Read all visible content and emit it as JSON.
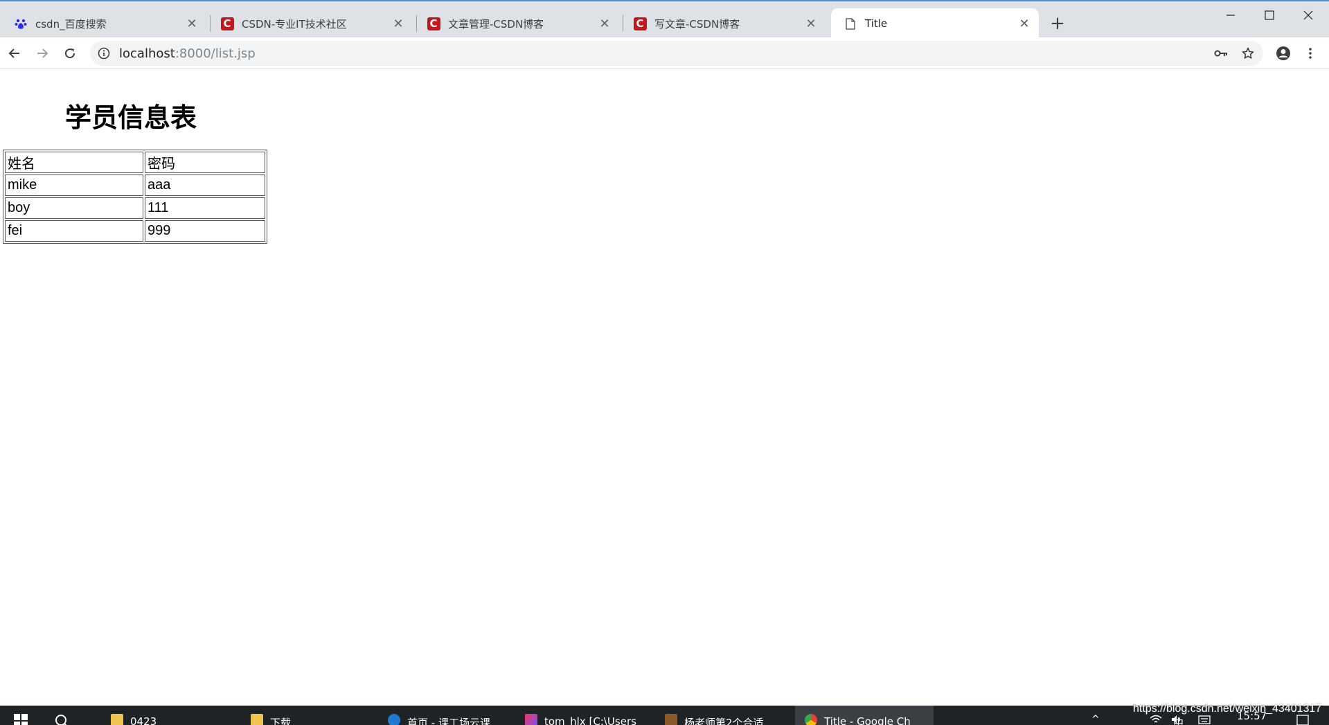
{
  "tabs": [
    {
      "title": "csdn_百度搜索",
      "icon": "baidu-paw-icon"
    },
    {
      "title": "CSDN-专业IT技术社区",
      "icon": "csdn-logo-icon"
    },
    {
      "title": "文章管理-CSDN博客",
      "icon": "csdn-logo-icon"
    },
    {
      "title": "写文章-CSDN博客",
      "icon": "csdn-logo-icon"
    },
    {
      "title": "Title",
      "icon": "document-icon",
      "active": true
    }
  ],
  "address_bar": {
    "host": "localhost",
    "path": ":8000/list.jsp"
  },
  "page": {
    "heading": "学员信息表",
    "table": {
      "headers": [
        "姓名",
        "密码"
      ],
      "rows": [
        [
          "mike",
          "aaa"
        ],
        [
          "boy",
          "111"
        ],
        [
          "fei",
          "999"
        ]
      ]
    }
  },
  "taskbar": {
    "items": [
      {
        "label": "0423",
        "icon": "folder-icon"
      },
      {
        "label": "下载",
        "icon": "folder-icon"
      },
      {
        "label": "首页 - 课工场云课",
        "icon": "edge-icon"
      },
      {
        "label": "tom_hlx [C:\\Users",
        "icon": "intellij-icon"
      },
      {
        "label": "杨老师第2个合适",
        "icon": "app-icon"
      },
      {
        "label": "Title - Google Ch",
        "icon": "chrome-icon",
        "active": true
      }
    ],
    "tray": {
      "ime": "中",
      "clock": "15:57"
    }
  },
  "watermark": "https://blog.csdn.net/weixin_43401317",
  "colors": {
    "tabstrip_bg": "#dee1e6",
    "csdn_red": "#c5161d",
    "taskbar_bg": "#1f2326"
  }
}
